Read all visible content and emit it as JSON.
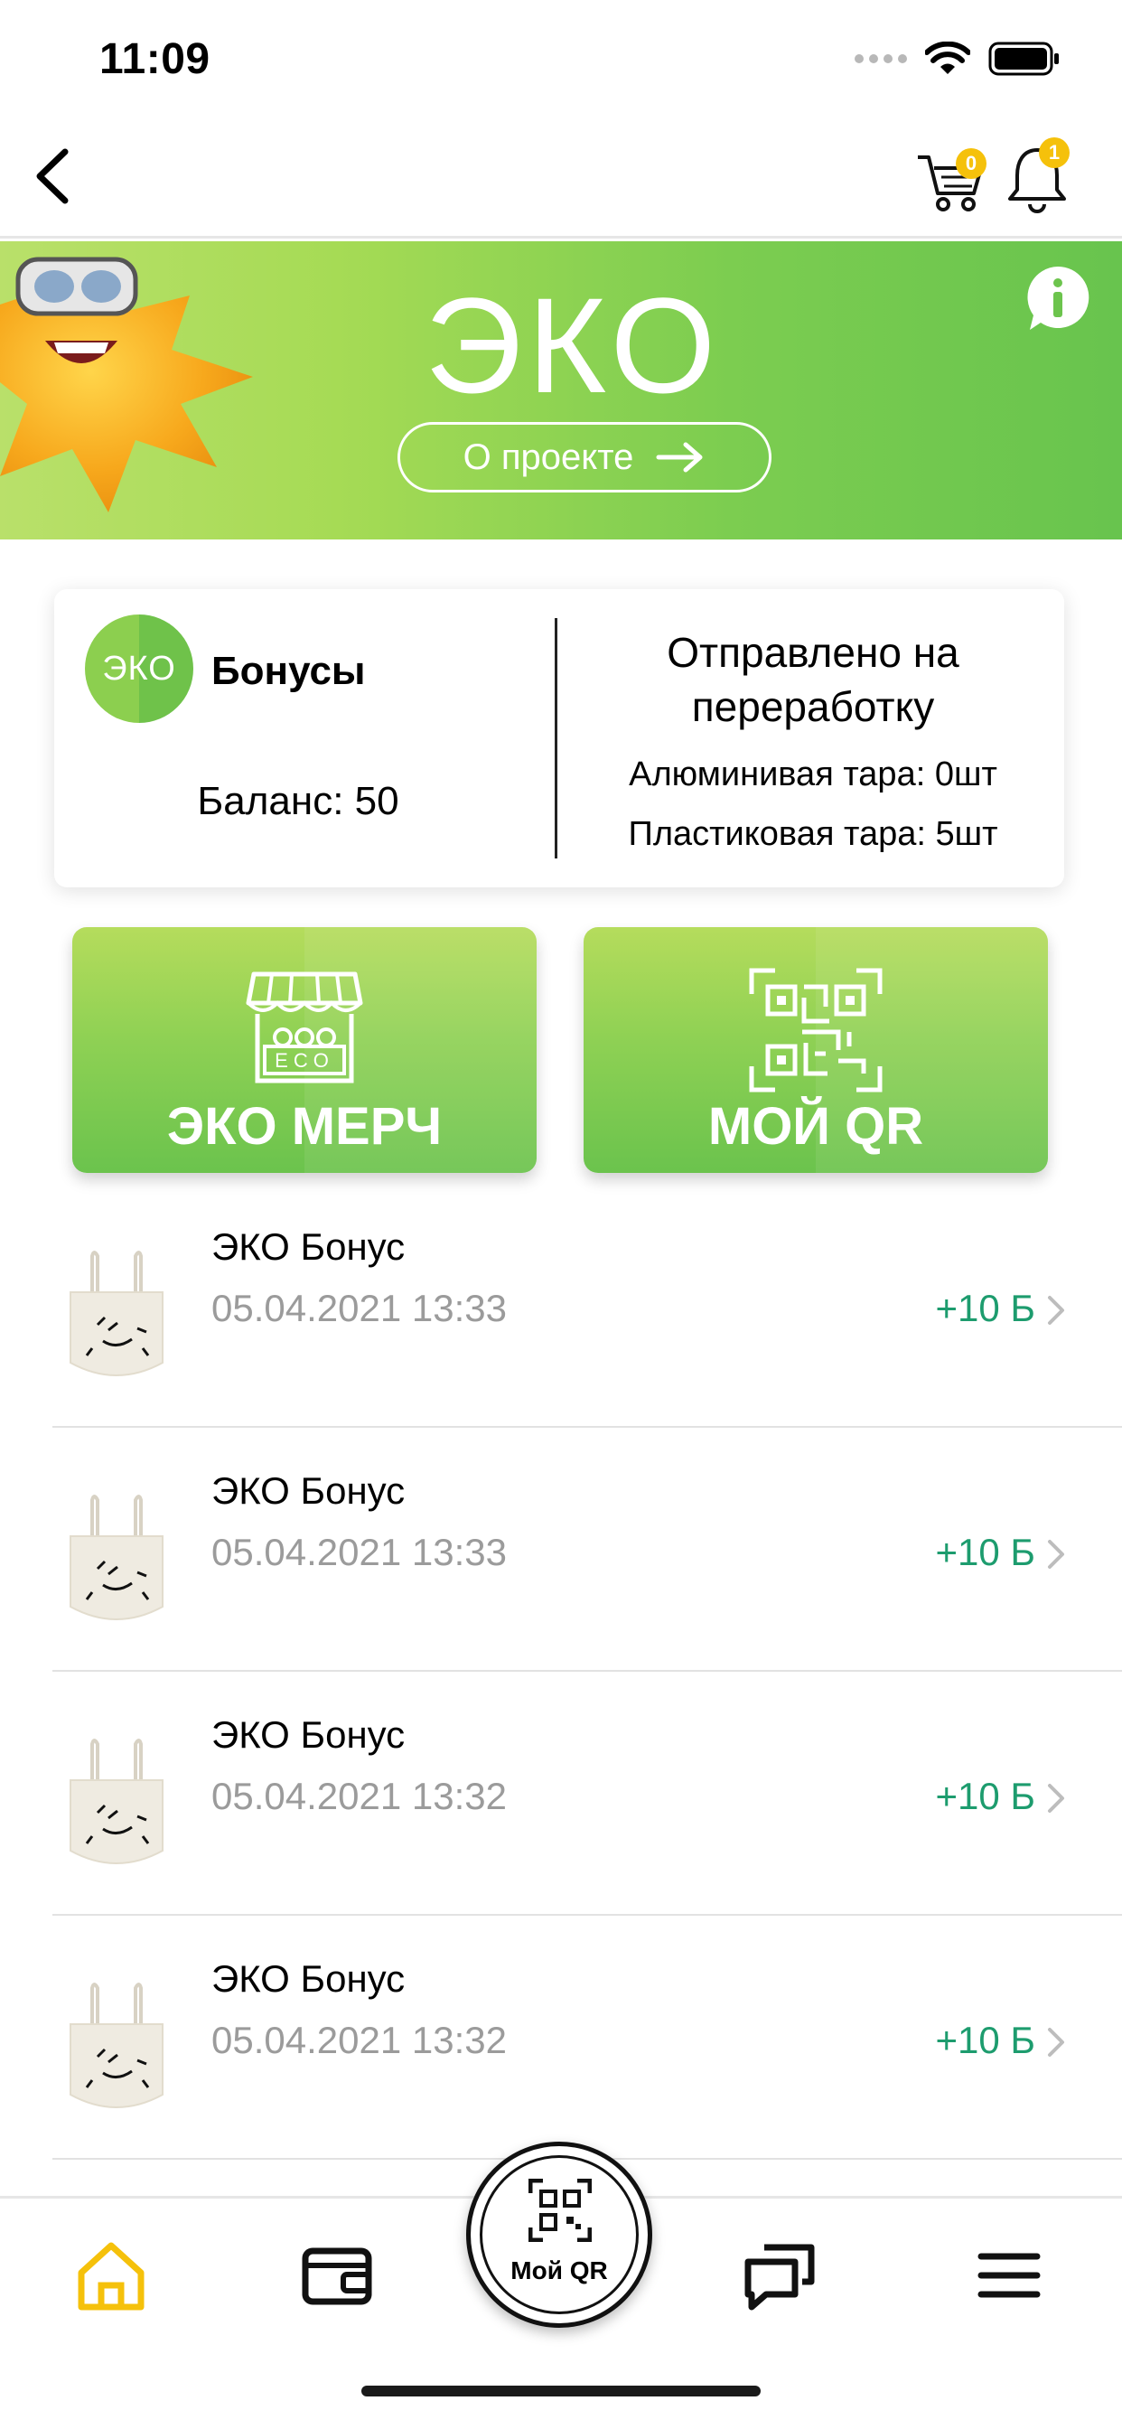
{
  "status": {
    "time": "11:09"
  },
  "nav": {
    "cart_count": "0",
    "notification_count": "1"
  },
  "banner": {
    "logo": "ЭКО",
    "about_label": "О проекте"
  },
  "bonus_card": {
    "logo": "ЭКО",
    "title": "Бонусы",
    "balance": "Баланс: 50",
    "sent_title": "Отправлено на переработку",
    "aluminium": "Алюминивая тара: 0шт",
    "plastic": "Пластиковая тара: 5шт"
  },
  "tiles": {
    "merch": "ЭКО МЕРЧ",
    "merch_sign": "ECO",
    "qr": "МОЙ QR"
  },
  "transactions": [
    {
      "title": "ЭКО Бонус",
      "date": "05.04.2021 13:33",
      "amount": "+10 Б"
    },
    {
      "title": "ЭКО Бонус",
      "date": "05.04.2021 13:33",
      "amount": "+10 Б"
    },
    {
      "title": "ЭКО Бонус",
      "date": "05.04.2021 13:32",
      "amount": "+10 Б"
    },
    {
      "title": "ЭКО Бонус",
      "date": "05.04.2021 13:32",
      "amount": "+10 Б"
    }
  ],
  "tabbar": {
    "qr_label": "Мой QR"
  },
  "colors": {
    "green": "#7ccd50",
    "badge": "#f5c10b",
    "amount": "#1d9c6e",
    "active_tab": "#f5c10b"
  }
}
